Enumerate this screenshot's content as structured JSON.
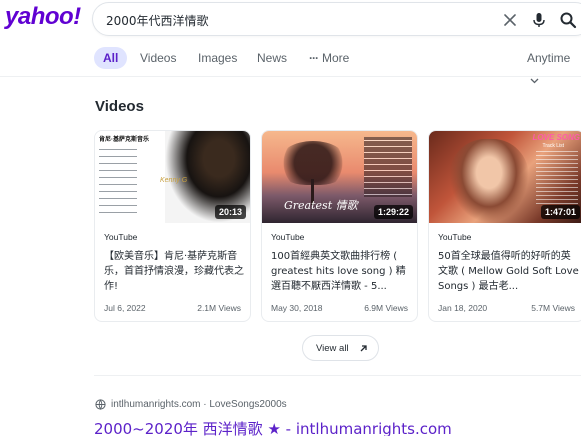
{
  "header": {
    "logo_text": "yahoo!",
    "search_query": "2000年代西洋情歌",
    "brand_color": "#6001d2"
  },
  "tabs": {
    "items": [
      {
        "label": "All",
        "active": true
      },
      {
        "label": "Videos",
        "active": false
      },
      {
        "label": "Images",
        "active": false
      },
      {
        "label": "News",
        "active": false
      },
      {
        "label": "More",
        "active": false
      }
    ],
    "time_filter": "Anytime"
  },
  "videos": {
    "title": "Videos",
    "cards": [
      {
        "source": "YouTube",
        "title": "【欧美音乐】肯尼·基萨克斯音乐，首首抒情浪漫，珍藏代表之作!",
        "duration": "20:13",
        "date": "Jul 6, 2022",
        "views": "2.1M Views",
        "thumb_heading": "肯尼·基萨克斯音乐",
        "thumb_overlay": "Kenny G"
      },
      {
        "source": "YouTube",
        "title": "100首經典英文歌曲排行榜 ( greatest hits love song ) 精選百聽不厭西洋情歌 - 5...",
        "duration": "1:29:22",
        "date": "May 30, 2018",
        "views": "6.9M Views",
        "thumb_overlay": "Greatest 情歌"
      },
      {
        "source": "YouTube",
        "title": "50首全球最值得听的好听的英文歌 ( Mellow Gold Soft Love Songs ) 最古老...",
        "duration": "1:47:01",
        "date": "Jan 18, 2020",
        "views": "5.7M Views",
        "thumb_heading": "LOVE SONG",
        "thumb_sub": "Track List"
      }
    ],
    "view_all_label": "View all"
  },
  "result": {
    "breadcrumb": "intlhumanrights.com · LoveSongs2000s",
    "title": "2000~2020年 西洋情歌 ★ - intlhumanrights.com",
    "link_color": "#5c22c9"
  }
}
